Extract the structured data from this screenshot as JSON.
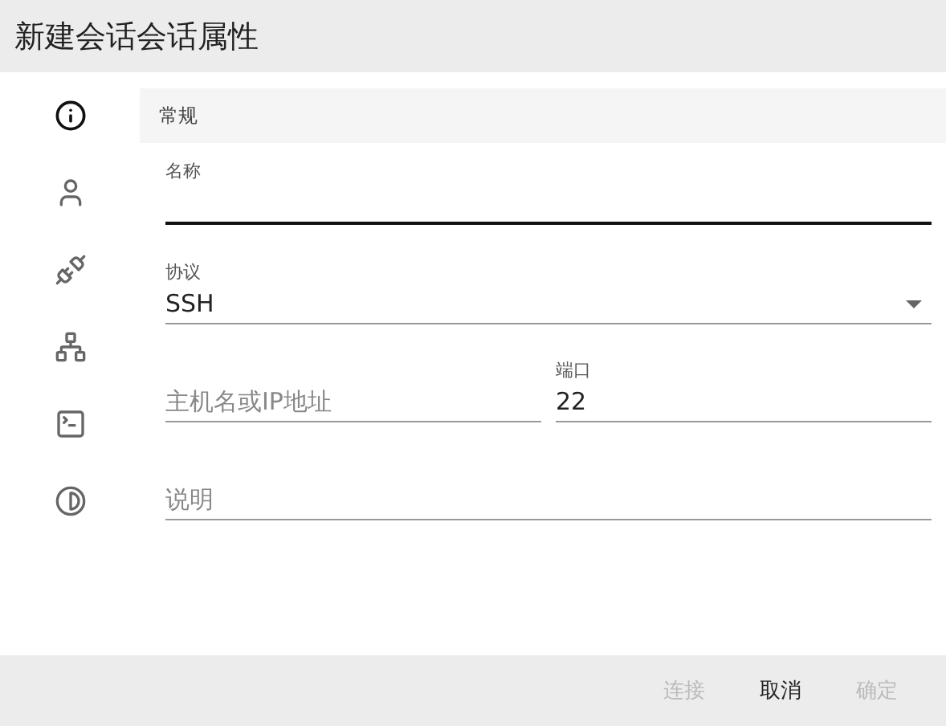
{
  "window": {
    "title": "新建会话会话属性"
  },
  "sidebar": {
    "items": [
      {
        "kind": "info",
        "selected": true
      },
      {
        "kind": "user",
        "selected": false
      },
      {
        "kind": "plug",
        "selected": false
      },
      {
        "kind": "network",
        "selected": false
      },
      {
        "kind": "terminal",
        "selected": false
      },
      {
        "kind": "contrast",
        "selected": false
      }
    ]
  },
  "section": {
    "title": "常规"
  },
  "fields": [
    {
      "kind": "text",
      "label": "名称",
      "focused": true
    },
    {
      "kind": "select",
      "label": "协议",
      "value": "SSH"
    },
    {
      "kind": "pair",
      "items": [
        {
          "placeholder": "主机名或IP地址"
        },
        {
          "label": "端口",
          "value": "22"
        }
      ]
    },
    {
      "kind": "text",
      "placeholder": "说明"
    }
  ],
  "buttons": [
    {
      "label": "连接",
      "disabled": true
    },
    {
      "label": "取消",
      "disabled": false
    },
    {
      "label": "确定",
      "disabled": true
    }
  ]
}
